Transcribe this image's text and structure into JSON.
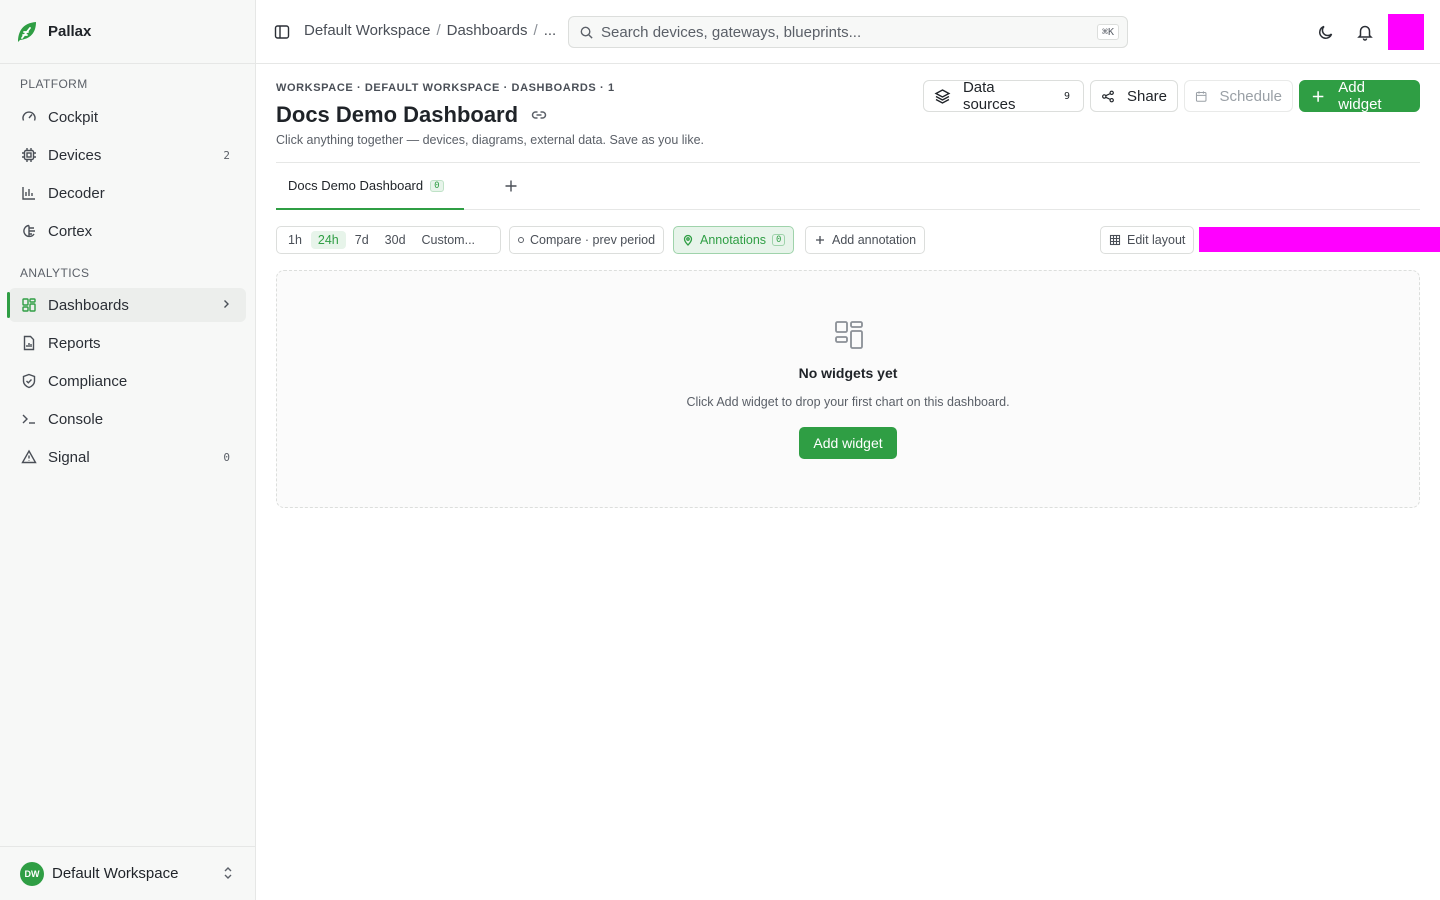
{
  "brand": {
    "name": "Pallax"
  },
  "sidebar": {
    "sections": [
      {
        "title": "PLATFORM"
      },
      {
        "title": "ANALYTICS"
      }
    ],
    "items": [
      {
        "label": "Cockpit",
        "icon": "gauge-icon"
      },
      {
        "label": "Devices",
        "icon": "chip-icon",
        "count": "2"
      },
      {
        "label": "Decoder",
        "icon": "bar-chart-icon"
      },
      {
        "label": "Cortex",
        "icon": "brain-icon"
      },
      {
        "label": "Dashboards",
        "icon": "layout-grid-icon",
        "active": true
      },
      {
        "label": "Reports",
        "icon": "document-chart-icon"
      },
      {
        "label": "Compliance",
        "icon": "shield-check-icon"
      },
      {
        "label": "Console",
        "icon": "terminal-icon"
      },
      {
        "label": "Signal",
        "icon": "alert-triangle-icon",
        "count": "0"
      }
    ],
    "workspace": {
      "initials": "DW",
      "name": "Default Workspace"
    }
  },
  "topbar": {
    "breadcrumbs": [
      "Default Workspace",
      "Dashboards",
      "..."
    ],
    "breadcrumb_sep": "/",
    "search_placeholder": "Search devices, gateways, blueprints...",
    "search_shortcut": "⌘K"
  },
  "header": {
    "kicker": "WORKSPACE · DEFAULT WORKSPACE · DASHBOARDS · 1",
    "title": "Docs Demo Dashboard",
    "subtitle": "Click anything together — devices, diagrams, external data. Save as you like.",
    "data_sources_label": "Data sources",
    "data_sources_count": "9",
    "share_label": "Share",
    "schedule_label": "Schedule",
    "add_widget_label": "Add widget"
  },
  "tabs": [
    {
      "label": "Docs Demo Dashboard",
      "count": "0"
    }
  ],
  "toolbar": {
    "ranges": [
      "1h",
      "24h",
      "7d",
      "30d",
      "Custom..."
    ],
    "active_range": "24h",
    "compare_label": "Compare · prev period",
    "annotations_label": "Annotations",
    "annotations_count": "0",
    "add_annotation_label": "Add annotation",
    "edit_layout_label": "Edit layout"
  },
  "empty_state": {
    "title": "No widgets yet",
    "description": "Click Add widget to drop your first chart on this dashboard.",
    "button_label": "Add widget"
  },
  "colors": {
    "accent": "#2f9e44",
    "placeholder_magenta": "#ff00ff"
  }
}
